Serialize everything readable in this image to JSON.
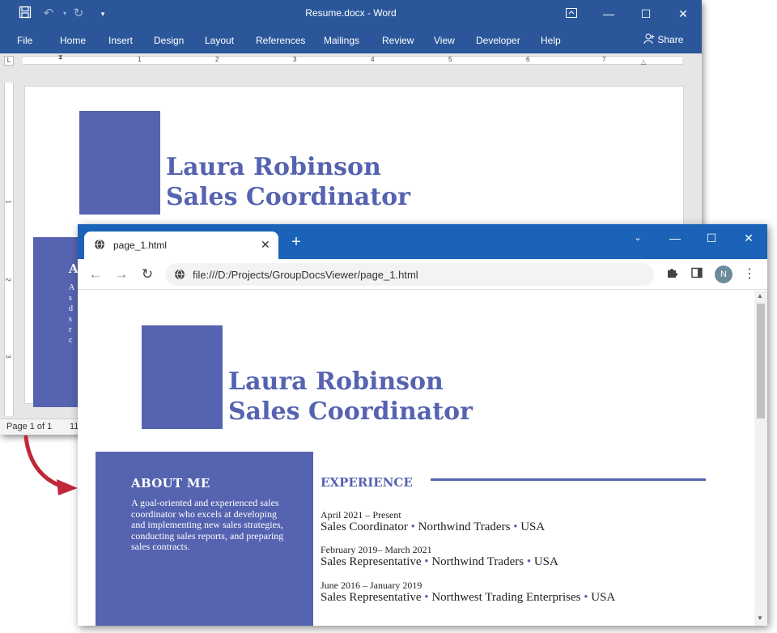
{
  "word": {
    "doc_title": "Resume.docx  -  Word",
    "ribbon_tabs": [
      "File",
      "Home",
      "Insert",
      "Design",
      "Layout",
      "References",
      "Mailings",
      "Review",
      "View",
      "Developer",
      "Help"
    ],
    "share_label": "Share",
    "ruler_numbers": [
      "1",
      "2",
      "3",
      "4",
      "5",
      "6",
      "7"
    ],
    "vruler_numbers": [
      "1",
      "2",
      "3"
    ],
    "status_page": "Page 1 of 1",
    "status_words": "11"
  },
  "browser": {
    "tab_title": "page_1.html",
    "url": "file:///D:/Projects/GroupDocsViewer/page_1.html",
    "avatar_letter": "N"
  },
  "resume": {
    "name": "Laura Robinson",
    "title": "Sales Coordinator",
    "about_heading": "ABOUT ME",
    "about_text": "A goal-oriented and experienced sales coordinator who excels at developing and implementing new sales strategies, conducting sales reports, and preparing sales contracts.",
    "experience_heading": "EXPERIENCE",
    "jobs": [
      {
        "dates": "April 2021 – Present",
        "role": "Sales Coordinator",
        "company": "Northwind Traders",
        "country": "USA"
      },
      {
        "dates": "February 2019– March 2021",
        "role": "Sales Representative",
        "company": "Northwind Traders",
        "country": "USA"
      },
      {
        "dates": "June 2016 – January 2019",
        "role": "Sales Representative",
        "company": "Northwest Trading Enterprises",
        "country": "USA"
      }
    ],
    "separator": "•",
    "word_about_preview": "A"
  },
  "colors": {
    "word_blue": "#2b579a",
    "chrome_blue": "#1a63b8",
    "resume_accent": "#5563b0",
    "arrow_red": "#c0283a"
  }
}
